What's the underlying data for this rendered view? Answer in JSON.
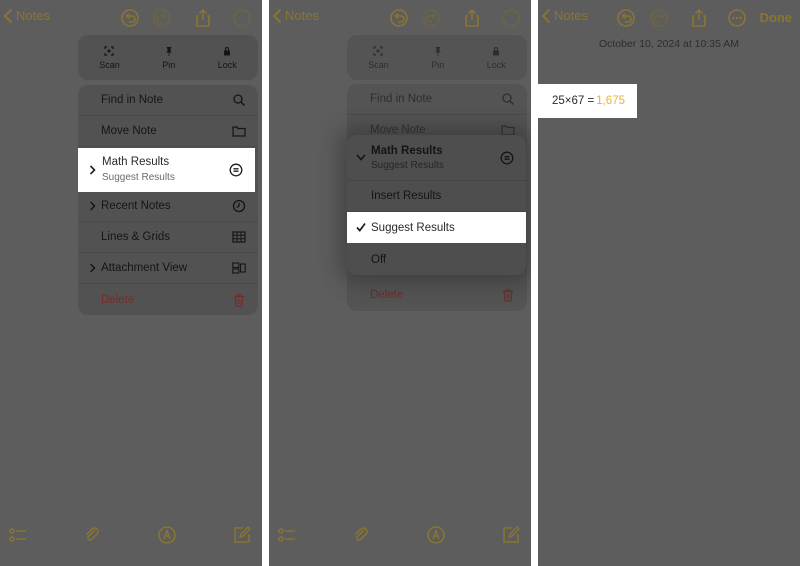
{
  "colors": {
    "accent": "#8a7532",
    "result": "#e9b531",
    "delete": "#7a2a25"
  },
  "panel1": {
    "back_label": "Notes",
    "quick_actions": [
      {
        "label": "Scan",
        "icon": "scan-icon"
      },
      {
        "label": "Pin",
        "icon": "pin-icon"
      },
      {
        "label": "Lock",
        "icon": "lock-icon"
      }
    ],
    "menu_items": [
      {
        "label": "Find in Note",
        "icon": "search-icon"
      },
      {
        "label": "Move Note",
        "icon": "folder-icon"
      },
      {
        "label": "Math Results",
        "sublabel": "Suggest Results",
        "icon": "equals-circle-icon"
      },
      {
        "label": "Recent Notes",
        "icon": "clock-icon"
      },
      {
        "label": "Lines & Grids",
        "icon": "grid-icon"
      },
      {
        "label": "Attachment View",
        "icon": "attachment-view-icon"
      },
      {
        "label": "Delete",
        "icon": "trash-icon"
      }
    ]
  },
  "panel2": {
    "back_label": "Notes",
    "quick_actions": [
      {
        "label": "Scan"
      },
      {
        "label": "Pin"
      },
      {
        "label": "Lock"
      }
    ],
    "bg_items": [
      {
        "label": "Find in Note"
      },
      {
        "label": "Move Note"
      },
      {
        "label": "Delete"
      }
    ],
    "submenu": {
      "header": "Math Results",
      "header_sub": "Suggest Results",
      "options": [
        {
          "label": "Insert Results",
          "checked": false
        },
        {
          "label": "Suggest Results",
          "checked": true
        },
        {
          "label": "Off",
          "checked": false
        }
      ]
    }
  },
  "panel3": {
    "back_label": "Notes",
    "done_label": "Done",
    "date": "October 10, 2024 at 10:35 AM",
    "expression": "25×67 =",
    "result": "1,675"
  }
}
